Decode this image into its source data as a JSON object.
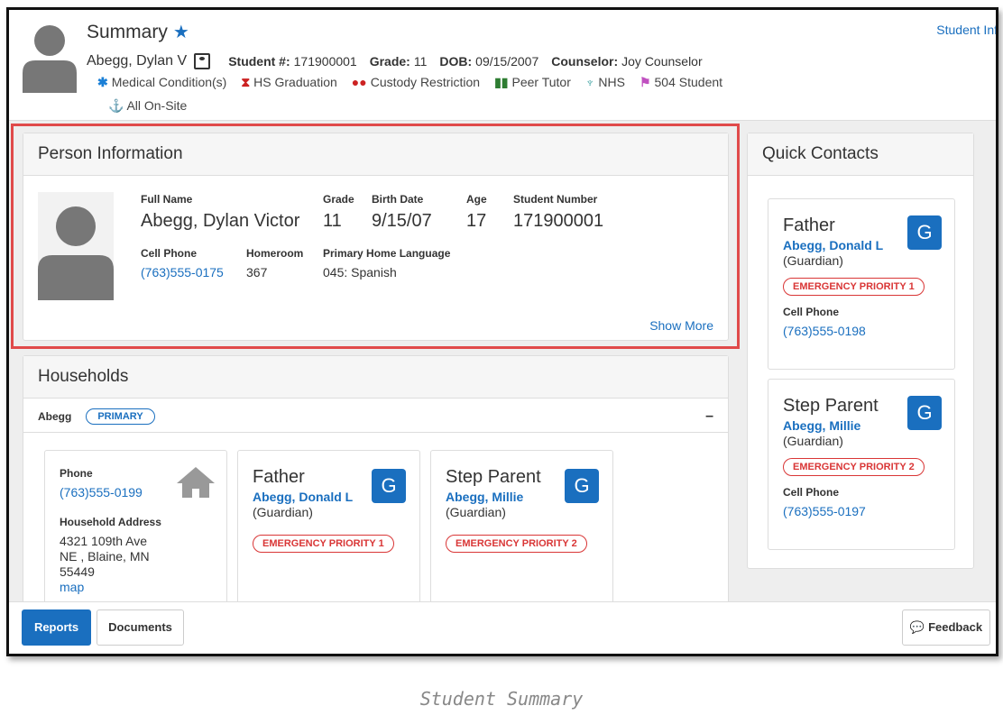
{
  "header": {
    "title": "Summary",
    "student_info_link": "Student Inf",
    "name": "Abegg, Dylan V",
    "student_num_label": "Student #:",
    "student_num": "171900001",
    "grade_label": "Grade:",
    "grade": "11",
    "dob_label": "DOB:",
    "dob": "09/15/2007",
    "counselor_label": "Counselor:",
    "counselor": "Joy Counselor",
    "flags": [
      {
        "label": "Medical Condition(s)",
        "icon": "asterisk-icon",
        "color": "#1a7fd6"
      },
      {
        "label": "HS Graduation",
        "icon": "graduation-icon",
        "color": "#cc2222"
      },
      {
        "label": "Custody Restriction",
        "icon": "people-icon",
        "color": "#cc2222"
      },
      {
        "label": "Peer Tutor",
        "icon": "book-icon",
        "color": "#2e7d32"
      },
      {
        "label": "NHS",
        "icon": "trophy-icon",
        "color": "#3aa0a0"
      },
      {
        "label": "504 Student",
        "icon": "flag-icon",
        "color": "#c050c0"
      }
    ],
    "flag_extra": "All On-Site"
  },
  "person": {
    "heading": "Person Information",
    "full_name_label": "Full Name",
    "full_name": "Abegg, Dylan Victor",
    "grade_label": "Grade",
    "grade": "11",
    "birth_label": "Birth Date",
    "birth": "9/15/07",
    "age_label": "Age",
    "age": "17",
    "student_number_label": "Student Number",
    "student_number": "171900001",
    "cell_label": "Cell Phone",
    "cell": "(763)555-0175",
    "homeroom_label": "Homeroom",
    "homeroom": "367",
    "lang_label": "Primary Home Language",
    "lang": "045: Spanish",
    "show_more": "Show More"
  },
  "households": {
    "heading": "Households",
    "name": "Abegg",
    "badge": "PRIMARY",
    "collapse": "–",
    "home": {
      "phone_label": "Phone",
      "phone": "(763)555-0199",
      "address_label": "Household Address",
      "address1": "4321 109th Ave",
      "address2": "NE , Blaine, MN",
      "address3": "55449",
      "map": "map"
    },
    "members": [
      {
        "relation": "Father",
        "name": "Abegg, Donald L",
        "role": "(Guardian)",
        "priority": "EMERGENCY PRIORITY 1",
        "badge": "G"
      },
      {
        "relation": "Step Parent",
        "name": "Abegg, Millie",
        "role": "(Guardian)",
        "priority": "EMERGENCY PRIORITY 2",
        "badge": "G"
      }
    ]
  },
  "quick": {
    "heading": "Quick Contacts",
    "contacts": [
      {
        "relation": "Father",
        "name": "Abegg, Donald L",
        "role": "(Guardian)",
        "priority": "EMERGENCY PRIORITY 1",
        "phone_label": "Cell Phone",
        "phone": "(763)555-0198",
        "badge": "G"
      },
      {
        "relation": "Step Parent",
        "name": "Abegg, Millie",
        "role": "(Guardian)",
        "priority": "EMERGENCY PRIORITY 2",
        "phone_label": "Cell Phone",
        "phone": "(763)555-0197",
        "badge": "G"
      }
    ]
  },
  "footer": {
    "reports": "Reports",
    "documents": "Documents",
    "feedback": "Feedback"
  },
  "caption": "Student Summary"
}
